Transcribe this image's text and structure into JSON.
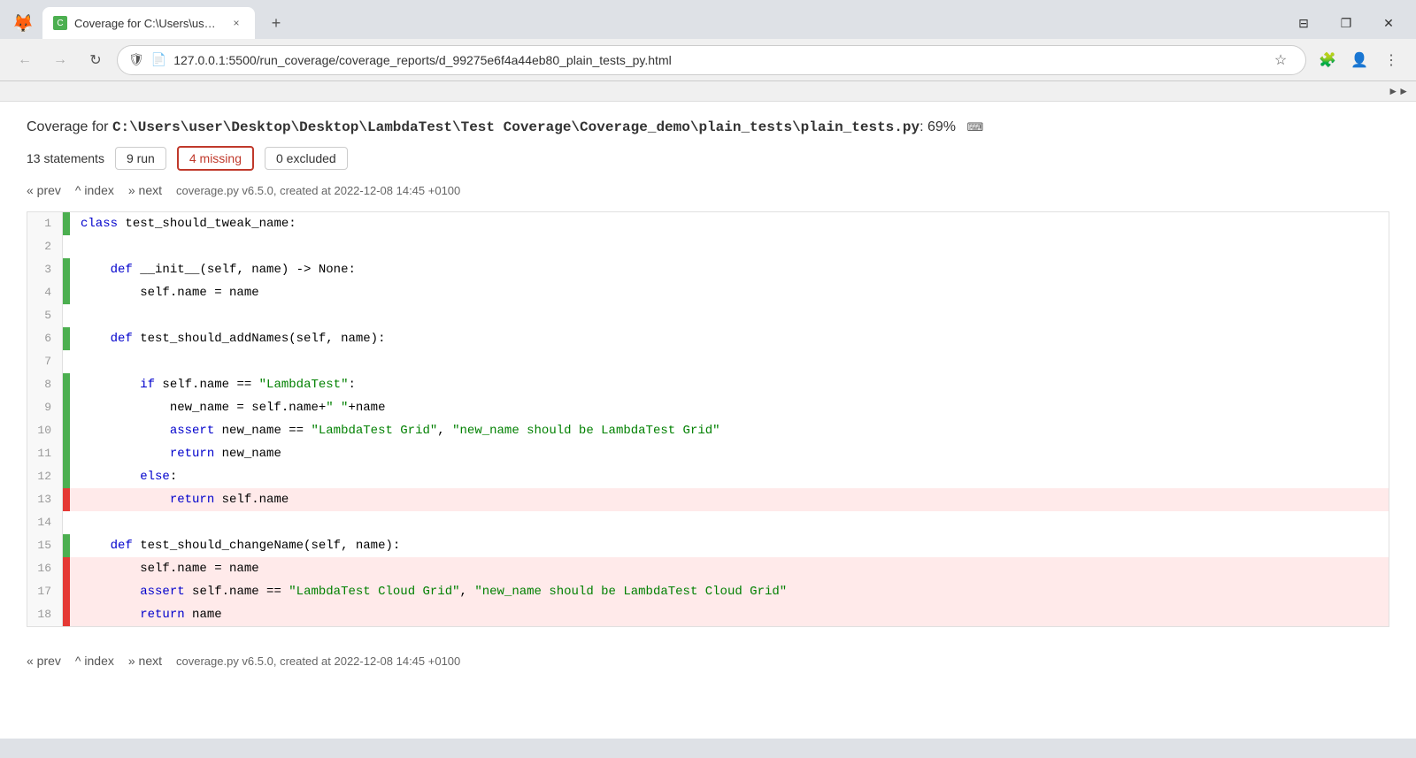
{
  "browser": {
    "tab_title": "Coverage for C:\\Users\\user\\Des...",
    "favicon_text": "C",
    "close_label": "×",
    "new_tab_label": "+",
    "window_minimize": "—",
    "window_restore": "❐",
    "window_close": "✕",
    "window_buttons_visible": "⊟"
  },
  "navbar": {
    "back_icon": "←",
    "forward_icon": "→",
    "reload_icon": "↺",
    "shield_icon": "🛡",
    "url": "127.0.0.1:5500/run_coverage/coverage_reports/d_99275e6f4a44eb80_plain_tests_py.html",
    "bookmark_icon": "☆",
    "profile_icon": "👤",
    "extensions_icon": "⋮",
    "sidebar_icon": "⊞"
  },
  "coverage": {
    "title_prefix": "Coverage for ",
    "title_path": "C:\\Users\\user\\Desktop\\Desktop\\LambdaTest\\Test Coverage\\Coverage_demo\\plain_tests\\plain_tests.py",
    "title_percent": ": 69%",
    "stats": [
      {
        "label": "13 statements",
        "type": "plain"
      },
      {
        "label": "9 run",
        "type": "normal"
      },
      {
        "label": "4 missing",
        "type": "missing"
      },
      {
        "label": "0 excluded",
        "type": "normal"
      }
    ],
    "nav_links": [
      {
        "label": "« prev",
        "type": "link"
      },
      {
        "label": "^ index",
        "type": "link"
      },
      {
        "label": "» next",
        "type": "link"
      }
    ],
    "coverage_info": "coverage.py v6.5.0, created at 2022-12-08 14:45 +0100"
  },
  "code": {
    "lines": [
      {
        "num": 1,
        "indicator": "run",
        "content": "class test_should_tweak_name:",
        "missing": false
      },
      {
        "num": 2,
        "indicator": "",
        "content": "",
        "missing": false
      },
      {
        "num": 3,
        "indicator": "run",
        "content": "    def __init__(self, name) -> None:",
        "missing": false
      },
      {
        "num": 4,
        "indicator": "run",
        "content": "        self.name = name",
        "missing": false
      },
      {
        "num": 5,
        "indicator": "",
        "content": "",
        "missing": false
      },
      {
        "num": 6,
        "indicator": "run",
        "content": "    def test_should_addNames(self, name):",
        "missing": false
      },
      {
        "num": 7,
        "indicator": "",
        "content": "",
        "missing": false
      },
      {
        "num": 8,
        "indicator": "run",
        "content": "        if self.name == \"LambdaTest\":",
        "missing": false
      },
      {
        "num": 9,
        "indicator": "run",
        "content": "            new_name = self.name+\" \"+name",
        "missing": false
      },
      {
        "num": 10,
        "indicator": "run",
        "content": "            assert new_name == \"LambdaTest Grid\", \"new_name should be LambdaTest Grid\"",
        "missing": false
      },
      {
        "num": 11,
        "indicator": "run",
        "content": "            return new_name",
        "missing": false
      },
      {
        "num": 12,
        "indicator": "run",
        "content": "        else:",
        "missing": false
      },
      {
        "num": 13,
        "indicator": "missing",
        "content": "            return self.name",
        "missing": true
      },
      {
        "num": 14,
        "indicator": "",
        "content": "",
        "missing": false
      },
      {
        "num": 15,
        "indicator": "run",
        "content": "    def test_should_changeName(self, name):",
        "missing": false
      },
      {
        "num": 16,
        "indicator": "missing",
        "content": "        self.name = name",
        "missing": true
      },
      {
        "num": 17,
        "indicator": "missing",
        "content": "        assert self.name == \"LambdaTest Cloud Grid\", \"new_name should be LambdaTest Cloud Grid\"",
        "missing": true
      },
      {
        "num": 18,
        "indicator": "missing",
        "content": "        return name",
        "missing": true
      }
    ]
  },
  "bottom_nav": {
    "links": [
      {
        "label": "« prev"
      },
      {
        "label": "^ index"
      },
      {
        "label": "» next"
      }
    ],
    "info": "coverage.py v6.5.0, created at 2022-12-08 14:45 +0100"
  }
}
